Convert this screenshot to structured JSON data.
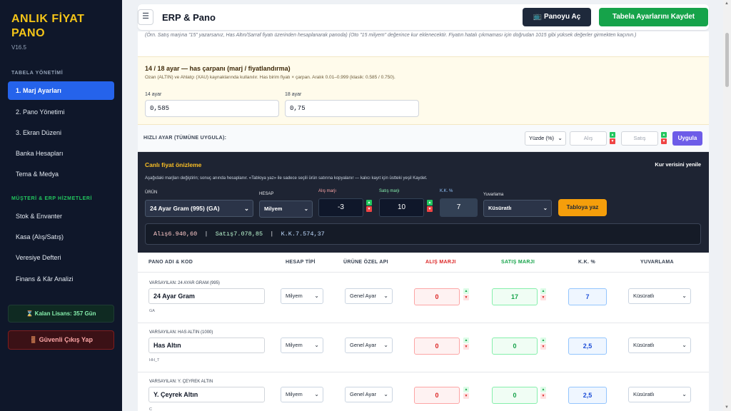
{
  "sidebar": {
    "brand_line1": "ANLIK FİYAT",
    "brand_line2": "PANO",
    "version": "V16.5",
    "section1": "TABELA YÖNETİMİ",
    "section2": "MÜŞTERİ & ERP HİZMETLERİ",
    "items": [
      {
        "label": "1. Marj Ayarları"
      },
      {
        "label": "2. Pano Yönetimi"
      },
      {
        "label": "3. Ekran Düzeni"
      },
      {
        "label": "Banka Hesapları"
      },
      {
        "label": "Tema & Medya"
      },
      {
        "label": "Stok & Envanter"
      },
      {
        "label": "Kasa (Alış/Satış)"
      },
      {
        "label": "Veresiye Defteri"
      },
      {
        "label": "Finans & Kâr Analizi"
      }
    ],
    "license": "⌛ Kalan Lisans: 357 Gün",
    "logout": "🚪 Güvenli Çıkış Yap"
  },
  "header": {
    "menu_icon": "☰",
    "title": "ERP & Pano",
    "open_panel": "📺 Panoyu Aç",
    "save": "Tabela Ayarlarını Kaydet"
  },
  "note": "(Örn. Satış marjına \"15\" yazarsanız, Has Altın/Sarraf fiyatı üzerinden hesaplanarak panoda) (Oto \"15 milyem\" değerince kur eklenecektir. Fiyatın hatalı çıkmaması için doğrudan 1015 gibi yüksek değerler girmekten kaçının.)",
  "panel14": {
    "title": "14 / 18 ayar — has çarpanı (marj / fiyatlandırma)",
    "desc": "Ozan (ALTIN) ve Ahlatçı (XAU) kaynaklarında kullanılır. Has birim fiyatı × çarpan. Aralık 0.01–0.999 (klasik: 0.585 / 0.750).",
    "label14": "14 ayar",
    "value14": "0,585",
    "label18": "18 ayar",
    "value18": "0,75"
  },
  "quick": {
    "label": "HIZLI AYAR (TÜMÜNE UYGULA):",
    "mode": "Yüzde (%)",
    "alis_placeholder": "Alış",
    "satis_placeholder": "Satış",
    "apply": "Uygula"
  },
  "preview": {
    "title": "Canlı fiyat önizleme",
    "refresh": "Kur verisini yenile",
    "desc": "Aşağıdaki marjları değiştirin; sonuç anında hesaplanır. «Tabloya yaz» ile sadece seçili ürün satırına kopyalanır — kalıcı kayıt için üstteki yeşil Kaydet.",
    "product_label": "ÜRÜN",
    "product": "24 Ayar Gram (995) (GA)",
    "hesap_label": "HESAP",
    "hesap": "Milyem",
    "alis_label": "Alış marjı",
    "alis": "-3",
    "satis_label": "Satış marjı",
    "satis": "10",
    "kk_label": "K.K. %",
    "kk": "7",
    "yuv_label": "Yuvarlama",
    "yuv": "Küsüratlı",
    "write": "Tabloya yaz",
    "res_alis": "Alış6.940,60",
    "res_satis": "Satış7.078,85",
    "res_kk": "K.K.7.574,37"
  },
  "table": {
    "headers": {
      "name": "PANO ADI & KOD",
      "hesap": "HESAP TİPİ",
      "api": "ÜRÜNE ÖZEL API",
      "alis": "ALIŞ MARJI",
      "satis": "SATIŞ MARJI",
      "kk": "K.K. %",
      "yuv": "YUVARLAMA"
    },
    "rows": [
      {
        "default": "VARSAYILAN: 24 AYAR GRAM (995)",
        "name": "24 Ayar Gram",
        "code": "GA",
        "hesap": "Milyem",
        "api": "Genel Ayar",
        "alis": "0",
        "satis": "17",
        "kk": "7",
        "yuv": "Küsüratlı"
      },
      {
        "default": "VARSAYILAN: HAS ALTIN (1000)",
        "name": "Has Altın",
        "code": "HH_T",
        "hesap": "Milyem",
        "api": "Genel Ayar",
        "alis": "0",
        "satis": "0",
        "kk": "2,5",
        "yuv": "Küsüratlı"
      },
      {
        "default": "VARSAYILAN: Y. ÇEYREK ALTIN",
        "name": "Y. Çeyrek Altın",
        "code": "C",
        "hesap": "Milyem",
        "api": "Genel Ayar",
        "alis": "0",
        "satis": "0",
        "kk": "2,5",
        "yuv": "Küsüratlı"
      }
    ]
  },
  "colors": {
    "sidebar_bg": "#0f172a",
    "brand": "#f5c518",
    "active": "#2563eb",
    "save_green": "#16a34a",
    "preview_bg": "#1e2433",
    "accent_orange": "#f59e0b",
    "apply_purple": "#6d5ce8"
  }
}
